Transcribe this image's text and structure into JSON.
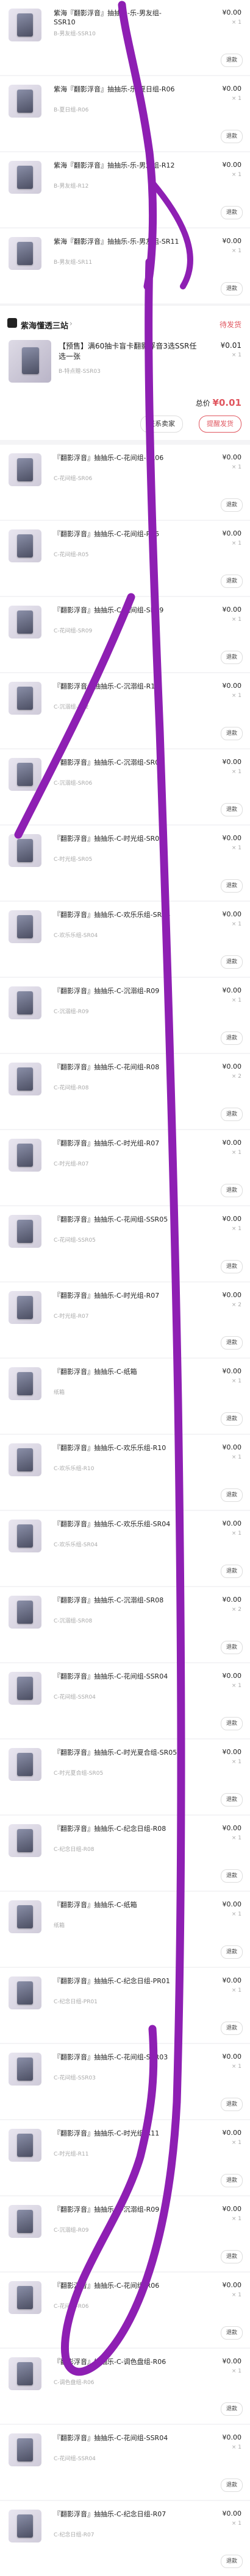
{
  "rows_top": [
    {
      "title": "紫海『翻影浮音』抽抽乐-乐-男友组-SSR10",
      "sub": "B-男友组-SSR10",
      "price": "¥0.00",
      "qty": "× 1",
      "refund": "退款"
    },
    {
      "title": "紫海『翻影浮音』抽抽乐-乐-夏日组-R06",
      "sub": "B-夏日组-R06",
      "price": "¥0.00",
      "qty": "× 1",
      "refund": "退款"
    },
    {
      "title": "紫海『翻影浮音』抽抽乐-乐-男友组-R12",
      "sub": "B-男友组-R12",
      "price": "¥0.00",
      "qty": "× 1",
      "refund": "退款"
    },
    {
      "title": "紫海『翻影浮音』抽抽乐-乐-男友组-SR11",
      "sub": "B-男友组-SR11",
      "price": "¥0.00",
      "qty": "× 1",
      "refund": "退款"
    }
  ],
  "shop": {
    "name": "紫海懂透三站",
    "chevron": "›",
    "status": "待发货",
    "item_title": "【预售】满60抽卡盲卡翻影浮音3选SSR任选一张",
    "item_sub": "B-特点赠-SSR03",
    "item_price": "¥0.01",
    "item_qty": "× 1",
    "total_label": "总价",
    "total_value": "¥0.01",
    "btn_contact": "联系卖家",
    "btn_remind": "提醒发货"
  },
  "rows_bottom": [
    {
      "title": "『翻影浮音』抽抽乐-C-花间组-SR06",
      "sub": "C-花间组-SR06",
      "price": "¥0.00",
      "qty": "× 1",
      "refund": "退款"
    },
    {
      "title": "『翻影浮音』抽抽乐-C-花间组-R05",
      "sub": "C-花间组-R05",
      "price": "¥0.00",
      "qty": "× 1",
      "refund": "退款"
    },
    {
      "title": "『翻影浮音』抽抽乐-C-花间组-SR09",
      "sub": "C-花间组-SR09",
      "price": "¥0.00",
      "qty": "× 1",
      "refund": "退款"
    },
    {
      "title": "『翻影浮音』抽抽乐-C-沉溺组-R12",
      "sub": "C-沉溺组-R12",
      "price": "¥0.00",
      "qty": "× 1",
      "refund": "退款"
    },
    {
      "title": "『翻影浮音』抽抽乐-C-沉溺组-SR06",
      "sub": "C-沉溺组-SR06",
      "price": "¥0.00",
      "qty": "× 1",
      "refund": "退款"
    },
    {
      "title": "『翻影浮音』抽抽乐-C-时光组-SR05",
      "sub": "C-时光组-SR05",
      "price": "¥0.00",
      "qty": "× 1",
      "refund": "退款"
    },
    {
      "title": "『翻影浮音』抽抽乐-C-欢乐乐组-SR04",
      "sub": "C-欢乐乐组-SR04",
      "price": "¥0.00",
      "qty": "× 1",
      "refund": "退款"
    },
    {
      "title": "『翻影浮音』抽抽乐-C-沉溺组-R09",
      "sub": "C-沉溺组-R09",
      "price": "¥0.00",
      "qty": "× 1",
      "refund": "退款"
    },
    {
      "title": "『翻影浮音』抽抽乐-C-花间组-R08",
      "sub": "C-花间组-R08",
      "price": "¥0.00",
      "qty": "× 2",
      "refund": "退款"
    },
    {
      "title": "『翻影浮音』抽抽乐-C-时光组-R07",
      "sub": "C-时光组-R07",
      "price": "¥0.00",
      "qty": "× 1",
      "refund": "退款"
    },
    {
      "title": "『翻影浮音』抽抽乐-C-花间组-SSR05",
      "sub": "C-花间组-SSR05",
      "price": "¥0.00",
      "qty": "× 1",
      "refund": "退款"
    },
    {
      "title": "『翻影浮音』抽抽乐-C-时光组-R07",
      "sub": "C-时光组-R07",
      "price": "¥0.00",
      "qty": "× 2",
      "refund": "退款"
    },
    {
      "title": "『翻影浮音』抽抽乐-C-纸箱",
      "sub": "纸箱",
      "price": "¥0.00",
      "qty": "× 1",
      "refund": "退款"
    },
    {
      "title": "『翻影浮音』抽抽乐-C-欢乐乐组-R10",
      "sub": "C-欢乐乐组-R10",
      "price": "¥0.00",
      "qty": "× 1",
      "refund": "退款"
    },
    {
      "title": "『翻影浮音』抽抽乐-C-欢乐乐组-SR04",
      "sub": "C-欢乐乐组-SR04",
      "price": "¥0.00",
      "qty": "× 1",
      "refund": "退款"
    },
    {
      "title": "『翻影浮音』抽抽乐-C-沉溺组-SR08",
      "sub": "C-沉溺组-SR08",
      "price": "¥0.00",
      "qty": "× 2",
      "refund": "退款"
    },
    {
      "title": "『翻影浮音』抽抽乐-C-花间组-SSR04",
      "sub": "C-花间组-SSR04",
      "price": "¥0.00",
      "qty": "× 1",
      "refund": "退款"
    },
    {
      "title": "『翻影浮音』抽抽乐-C-时光夏合组-SR05",
      "sub": "C-时光夏合组-SR05",
      "price": "¥0.00",
      "qty": "× 1",
      "refund": "退款"
    },
    {
      "title": "『翻影浮音』抽抽乐-C-纪念日组-R08",
      "sub": "C-纪念日组-R08",
      "price": "¥0.00",
      "qty": "× 1",
      "refund": "退款"
    },
    {
      "title": "『翻影浮音』抽抽乐-C-纸箱",
      "sub": "纸箱",
      "price": "¥0.00",
      "qty": "× 1",
      "refund": "退款"
    },
    {
      "title": "『翻影浮音』抽抽乐-C-纪念日组-PR01",
      "sub": "C-纪念日组-PR01",
      "price": "¥0.00",
      "qty": "× 1",
      "refund": "退款"
    },
    {
      "title": "『翻影浮音』抽抽乐-C-花间组-SSR03",
      "sub": "C-花间组-SSR03",
      "price": "¥0.00",
      "qty": "× 1",
      "refund": "退款"
    },
    {
      "title": "『翻影浮音』抽抽乐-C-时光组-R11",
      "sub": "C-时光组-R11",
      "price": "¥0.00",
      "qty": "× 1",
      "refund": "退款"
    },
    {
      "title": "『翻影浮音』抽抽乐-C-沉溺组-R09",
      "sub": "C-沉溺组-R09",
      "price": "¥0.00",
      "qty": "× 1",
      "refund": "退款"
    },
    {
      "title": "『翻影浮音』抽抽乐-C-花间组-R06",
      "sub": "C-花间组-R06",
      "price": "¥0.00",
      "qty": "× 1",
      "refund": "退款"
    },
    {
      "title": "『翻影浮音』抽抽乐-C-调色盘组-R06",
      "sub": "C-调色盘组-R06",
      "price": "¥0.00",
      "qty": "× 1",
      "refund": "退款"
    },
    {
      "title": "『翻影浮音』抽抽乐-C-花间组-SSR04",
      "sub": "C-花间组-SSR04",
      "price": "¥0.00",
      "qty": "× 1",
      "refund": "退款"
    },
    {
      "title": "『翻影浮音』抽抽乐-C-纪念日组-R07",
      "sub": "C-纪念日组-R07",
      "price": "¥0.00",
      "qty": "× 1",
      "refund": "退款"
    }
  ],
  "colors": {
    "accent": "#e0565f",
    "scribble": "#8e1fb3",
    "background": "#f4f4f6"
  }
}
